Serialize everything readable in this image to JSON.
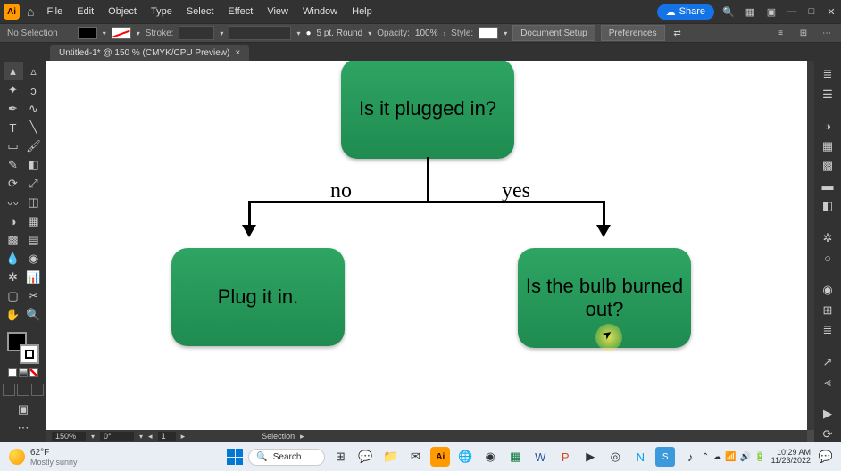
{
  "menubar": {
    "logo": "Ai",
    "items": [
      "File",
      "Edit",
      "Object",
      "Type",
      "Select",
      "Effect",
      "View",
      "Window",
      "Help"
    ],
    "share": "Share"
  },
  "controlbar": {
    "selection_state": "No Selection",
    "stroke_label": "Stroke:",
    "stroke_val": "",
    "point_val": "5 pt. Round",
    "opacity_label": "Opacity:",
    "opacity_val": "100%",
    "style_label": "Style:",
    "doc_setup": "Document Setup",
    "prefs": "Preferences"
  },
  "tab": {
    "title": "Untitled-1* @ 150 % (CMYK/CPU Preview)"
  },
  "status": {
    "zoom": "150%",
    "angle": "0°",
    "artboard": "1",
    "selection": "Selection"
  },
  "flow": {
    "q1": "Is it plugged in?",
    "no": "no",
    "yes": "yes",
    "a_no": "Plug it in.",
    "q2": "Is the bulb burned out?"
  },
  "taskbar": {
    "temp": "62°F",
    "temp_sub": "Mostly sunny",
    "search": "Search",
    "time": "10:29 AM",
    "date": "11/23/2022"
  }
}
